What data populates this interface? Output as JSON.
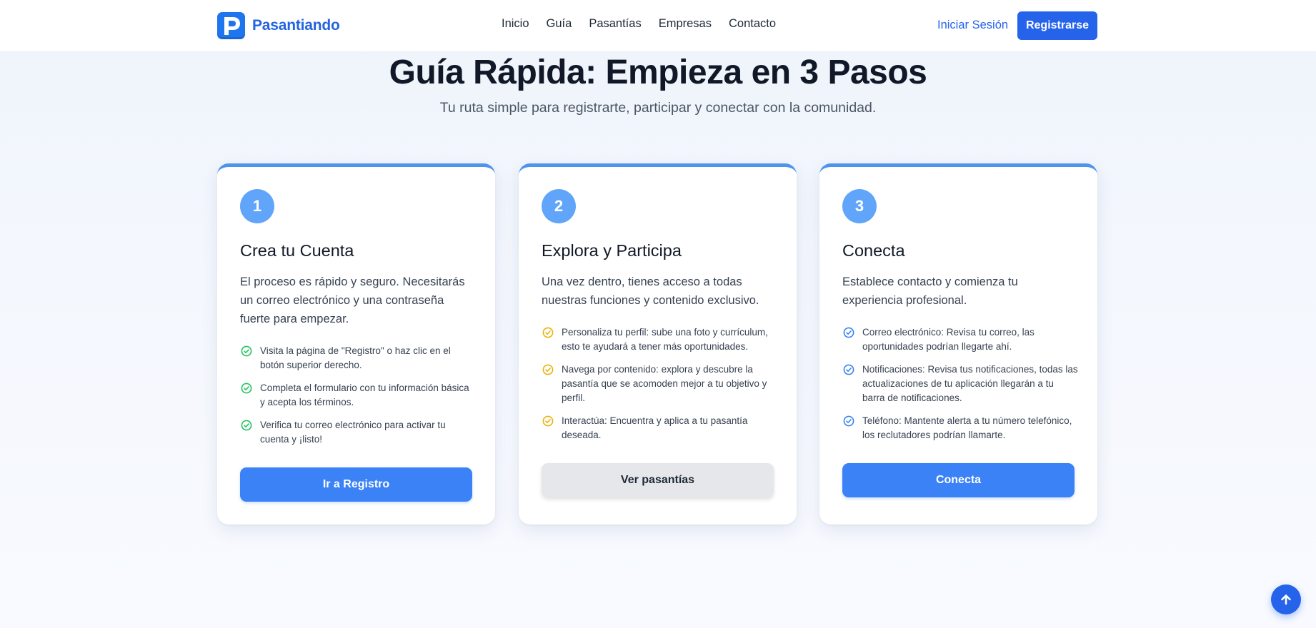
{
  "brand": {
    "name": "Pasantiando",
    "logo_letter": "P",
    "color": "#2364e0"
  },
  "nav": {
    "items": [
      "Inicio",
      "Guía",
      "Pasantías",
      "Empresas",
      "Contacto"
    ],
    "login_label": "Iniciar Sesión",
    "register_label": "Registrarse"
  },
  "hero": {
    "title": "Guía Rápida: Empieza en 3 Pasos",
    "subtitle": "Tu ruta simple para registrarte, participar y conectar con la comunidad."
  },
  "cards": [
    {
      "number": "1",
      "title": "Crea tu Cuenta",
      "description": "El proceso es rápido y seguro. Necesitarás un correo electrónico y una contraseña fuerte para empezar.",
      "check_color": "#22c55e",
      "steps": [
        "Visita la página de \"Registro\" o haz clic en el botón superior derecho.",
        "Completa el formulario con tu información básica y acepta los términos.",
        "Verifica tu correo electrónico para activar tu cuenta y ¡listo!"
      ],
      "button_label": "Ir a Registro"
    },
    {
      "number": "2",
      "title": "Explora y Participa",
      "description": "Una vez dentro, tienes acceso a todas nuestras funciones y contenido exclusivo.",
      "check_color": "#eab308",
      "steps": [
        "Personaliza tu perfil: sube una foto y currículum, esto te ayudará a tener más oportunidades.",
        "Navega por contenido: explora y descubre la pasantía que se acomoden mejor a tu objetivo y perfil.",
        "Interactúa: Encuentra y aplica a tu pasantía deseada."
      ],
      "button_label": "Ver pasantías"
    },
    {
      "number": "3",
      "title": "Conecta",
      "description": "Establece contacto y comienza tu experiencia profesional.",
      "check_color": "#3b82f6",
      "steps": [
        "Correo electrónico: Revisa tu correo, las oportunidades podrían llegarte ahí.",
        "Notificaciones: Revisa tus notificaciones, todas las actualizaciones de tu aplicación llegarán a tu barra de notificaciones.",
        "Teléfono: Mantente alerta a tu número telefónico, los reclutadores podrían llamarte."
      ],
      "button_label": "Conecta"
    }
  ],
  "icons": {
    "scroll_top": "arrow-up-icon",
    "check": "check-circle-icon"
  }
}
